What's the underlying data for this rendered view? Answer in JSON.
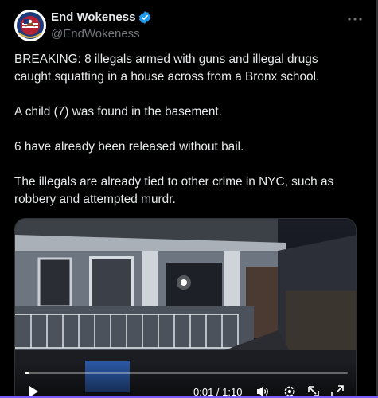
{
  "author": {
    "display_name": "End Wokeness",
    "handle": "@EndWokeness",
    "verified": true,
    "avatar_icon": "eagle-flag-emblem-icon"
  },
  "more_icon": "more-horizontal-icon",
  "tweet": {
    "paragraphs": [
      "BREAKING: 8 illegals armed with guns and illegal drugs caught squatting in a house across from a Bronx school.",
      "A child (7) was found in the basement.",
      "6 have already been released without bail.",
      "The illegals are already tied to other crime in NYC, such as robbery and attempted murdr."
    ]
  },
  "video": {
    "time_label": "0:01 / 1:10",
    "progress": 0.014,
    "controls": [
      "play-icon",
      "volume-icon",
      "settings-icon",
      "pip-icon",
      "fullscreen-icon"
    ]
  },
  "colors": {
    "background": "#000000",
    "text": "#e7e9ea",
    "secondary": "#71767b",
    "verified": "#1d9bf0",
    "border": "#2f3336"
  }
}
